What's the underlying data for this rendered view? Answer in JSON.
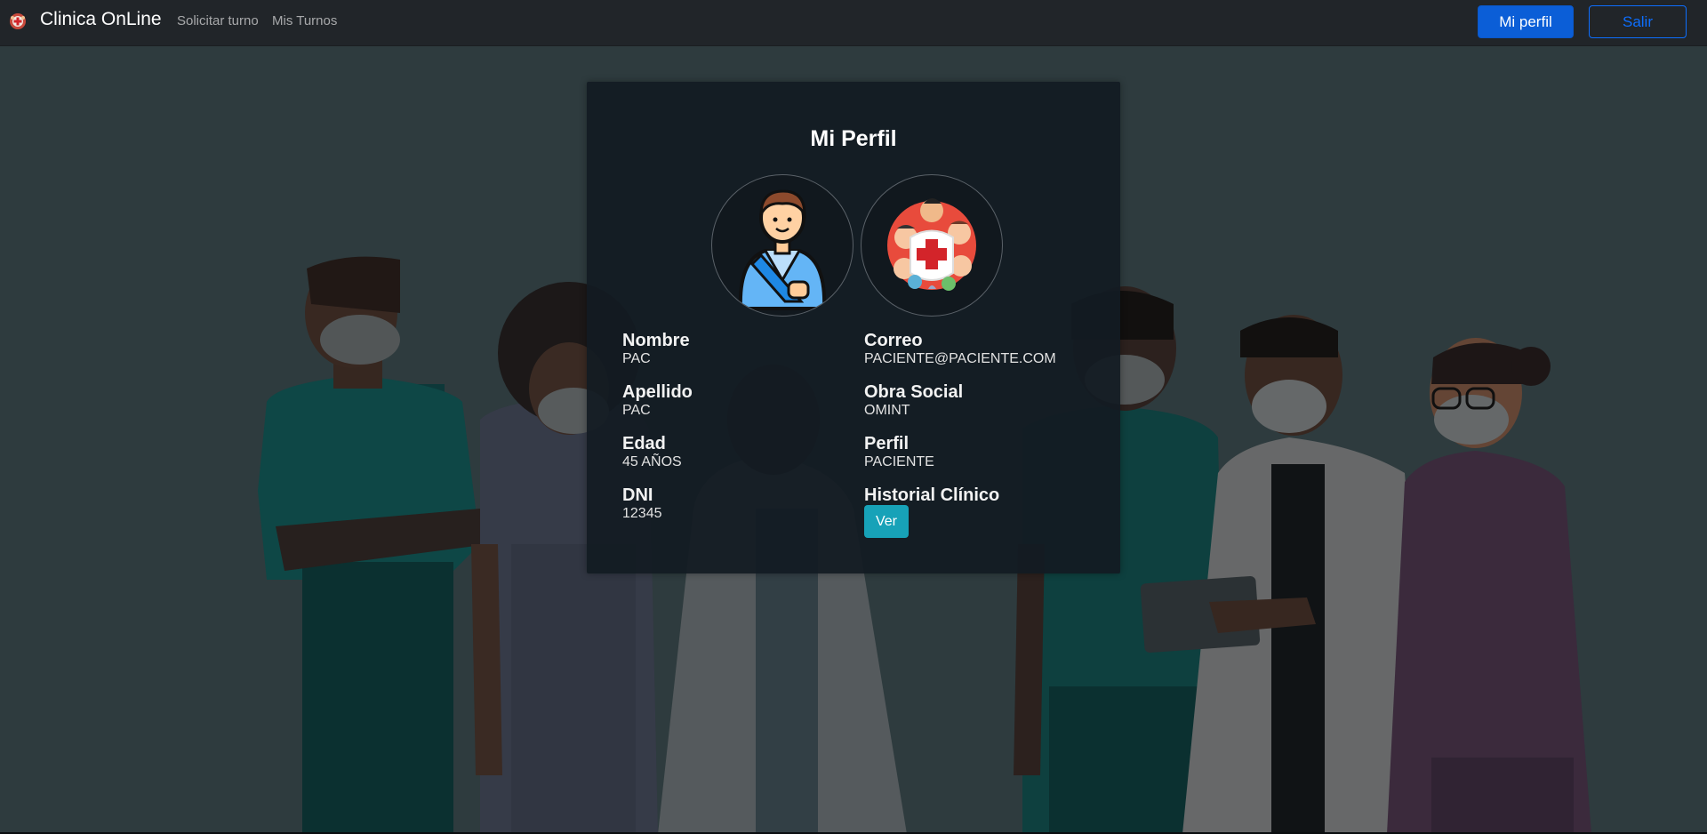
{
  "navbar": {
    "brand": "Clinica OnLine",
    "logo_icon": "clinic-logo-icon",
    "links": [
      "Solicitar turno",
      "Mis Turnos"
    ],
    "profile_button": "Mi perfil",
    "logout_button": "Salir"
  },
  "profile": {
    "title": "Mi Perfil",
    "avatar_icons": [
      "patient-avatar-icon",
      "medical-team-icon"
    ],
    "fields": {
      "nombre": {
        "label": "Nombre",
        "value": "PAC"
      },
      "apellido": {
        "label": "Apellido",
        "value": "PAC"
      },
      "edad": {
        "label": "Edad",
        "value": "45 AÑOS"
      },
      "dni": {
        "label": "DNI",
        "value": "12345"
      },
      "correo": {
        "label": "Correo",
        "value": "PACIENTE@PACIENTE.COM"
      },
      "obra_social": {
        "label": "Obra Social",
        "value": "OMINT"
      },
      "perfil": {
        "label": "Perfil",
        "value": "PACIENTE"
      },
      "historial": {
        "label": "Historial Clínico",
        "button": "Ver"
      }
    }
  },
  "colors": {
    "navbar_bg": "#212529",
    "primary": "#0b5ed7",
    "outline": "#0d6efd",
    "info": "#17a2b8",
    "background": "#313f42"
  }
}
